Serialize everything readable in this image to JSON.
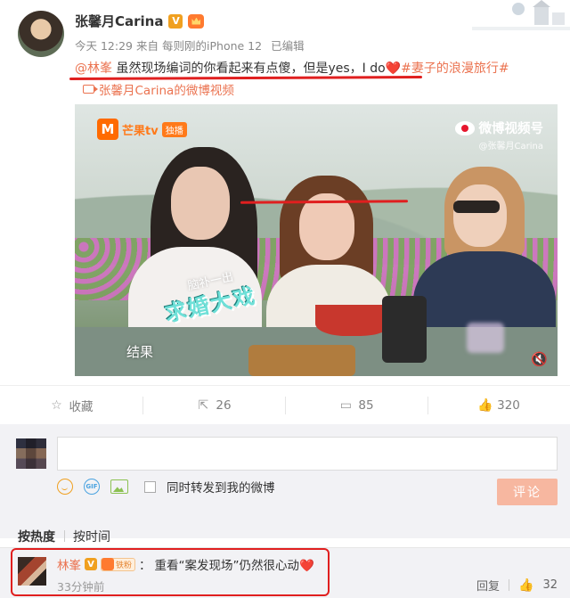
{
  "post": {
    "author": "张馨月Carina",
    "badges": {
      "verified": "V"
    },
    "meta": {
      "time": "今天 12:29",
      "source_prefix": "来自",
      "source": "每则刚的iPhone 12",
      "edited": "已编辑"
    },
    "text": {
      "mention": "@林峯",
      "body": " 虽然现场编词的你看起来有点傻，但是yes，I do",
      "heart": "❤️",
      "hashtag": "#妻子的浪漫旅行#"
    },
    "video_link": "张馨月Carina的微博视频"
  },
  "video": {
    "channel_logo": "芒果tv",
    "channel_tag": "独播",
    "platform": "微博视频号",
    "handle": "@张馨月Carina",
    "caption_small": "脑补一出",
    "caption_big": "求婚大戏",
    "caption_result": "结果"
  },
  "actions": {
    "favorite": "收藏",
    "repost": "26",
    "comment": "85",
    "like": "320"
  },
  "composer": {
    "input_placeholder": "",
    "forward_label": "同时转发到我的微博",
    "submit": "评论",
    "gif_label": "GIF"
  },
  "sort": {
    "hot": "按热度",
    "time": "按时间"
  },
  "comment": {
    "name": "林峯",
    "badge_verified": "V",
    "fan_level": "铁粉",
    "separator": "：",
    "text": "重看“案发现场”仍然很心动❤️",
    "time": "33分钟前",
    "reply": "回复",
    "likes": "32"
  },
  "colors": {
    "link_orange": "#eb7350",
    "annotation_red": "#e01f1f",
    "submit_disabled": "#f7b7a0"
  }
}
